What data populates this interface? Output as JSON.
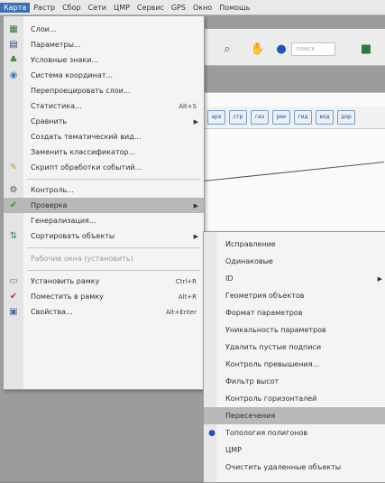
{
  "menubar": {
    "items": [
      "Карта",
      "Растр",
      "Сбор",
      "Сети",
      "ЦМР",
      "Сервис",
      "GPS",
      "Окно",
      "Помощь"
    ]
  },
  "toolbar": {
    "search_placeholder": "поиск"
  },
  "tabs": [
    "арх",
    "стр",
    "газ",
    "рек",
    "гид",
    "вод",
    "дор"
  ],
  "main_menu": {
    "items": [
      {
        "label": "Слои...",
        "icon": "layers-icon",
        "shortcut": ""
      },
      {
        "label": "Параметры...",
        "icon": "grid-icon",
        "shortcut": ""
      },
      {
        "label": "Условные знаки...",
        "icon": "tree-icon",
        "shortcut": ""
      },
      {
        "label": "Система координат...",
        "icon": "globe-icon",
        "shortcut": ""
      },
      {
        "label": "Перепроецировать слои...",
        "icon": "",
        "shortcut": ""
      },
      {
        "label": "Статистика...",
        "icon": "",
        "shortcut": "Alt+S"
      },
      {
        "label": "Сравнить",
        "icon": "",
        "shortcut": "",
        "submenu": true
      },
      {
        "label": "Создать тематический вид...",
        "icon": "",
        "shortcut": ""
      },
      {
        "label": "Заменить классификатор...",
        "icon": "",
        "shortcut": ""
      },
      {
        "label": "Скрипт обработки событий...",
        "icon": "script-icon",
        "shortcut": ""
      },
      {
        "label": "Контроль...",
        "icon": "check-tool-icon",
        "shortcut": ""
      },
      {
        "label": "Проверка",
        "icon": "check-green-icon",
        "shortcut": "",
        "submenu": true,
        "highlight": true
      },
      {
        "label": "Генерализация...",
        "icon": "",
        "shortcut": ""
      },
      {
        "label": "Сортировать объекты",
        "icon": "sort-icon",
        "shortcut": "",
        "submenu": true
      },
      {
        "label": "Рабочие окна (установить)",
        "icon": "",
        "shortcut": "",
        "disabled": true
      },
      {
        "label": "Установить рамку",
        "icon": "frame-icon",
        "shortcut": "Ctrl+R"
      },
      {
        "label": "Поместить в рамку",
        "icon": "check-red-icon",
        "shortcut": "Alt+R"
      },
      {
        "label": "Свойства...",
        "icon": "properties-icon",
        "shortcut": "Alt+Enter"
      }
    ]
  },
  "sub_menu": {
    "items": [
      {
        "label": "Исправление",
        "icon": ""
      },
      {
        "label": "Одинаковые",
        "icon": ""
      },
      {
        "label": "ID",
        "icon": "",
        "submenu": true
      },
      {
        "label": "Геометрия объектов",
        "icon": ""
      },
      {
        "label": "Формат параметров",
        "icon": ""
      },
      {
        "label": "Уникальность параметров",
        "icon": ""
      },
      {
        "label": "Удалить пустые подписи",
        "icon": ""
      },
      {
        "label": "Контроль превышения...",
        "icon": ""
      },
      {
        "label": "Фильтр высот",
        "icon": ""
      },
      {
        "label": "Контроль горизонталей",
        "icon": ""
      },
      {
        "label": "Пересечения",
        "icon": "",
        "highlight": true
      },
      {
        "label": "Топология полигонов",
        "icon": "info-icon"
      },
      {
        "label": "ЦМР",
        "icon": ""
      },
      {
        "label": "Очистить удаленные объекты",
        "icon": ""
      }
    ]
  },
  "colors": {
    "highlight": "#b8b8b8",
    "menubar_active": "#3b6fb6"
  }
}
